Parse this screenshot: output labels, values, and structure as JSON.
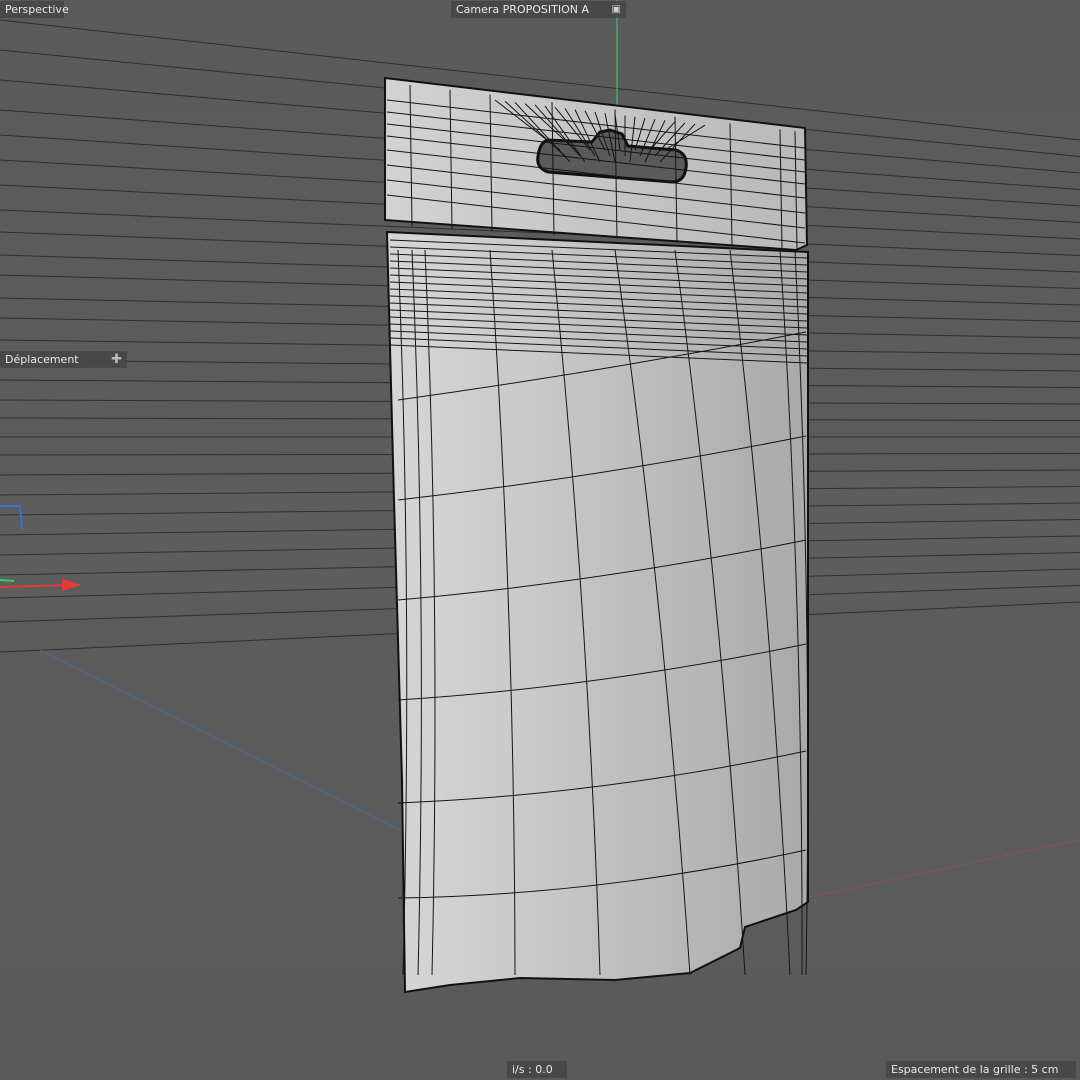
{
  "viewport": {
    "mode_label": "Perspective",
    "camera_label": "Camera PROPOSITION A",
    "camera_icon": "camera-link-icon",
    "tool_label": "Déplacement",
    "tool_icon": "move-crosshair-icon",
    "fps_label": "i/s : 0.0",
    "grid_spacing_label": "Espacement de la grille : 5 cm"
  },
  "colors": {
    "background": "#5b5b5b",
    "wireframe": "#121212",
    "mesh_fill": "#c4c4c4",
    "axis_x": "#e03a3a",
    "axis_y": "#2fcf6a",
    "axis_z": "#3a6fd8",
    "label_bg": "#464646",
    "label_text": "#e8e8e8"
  }
}
